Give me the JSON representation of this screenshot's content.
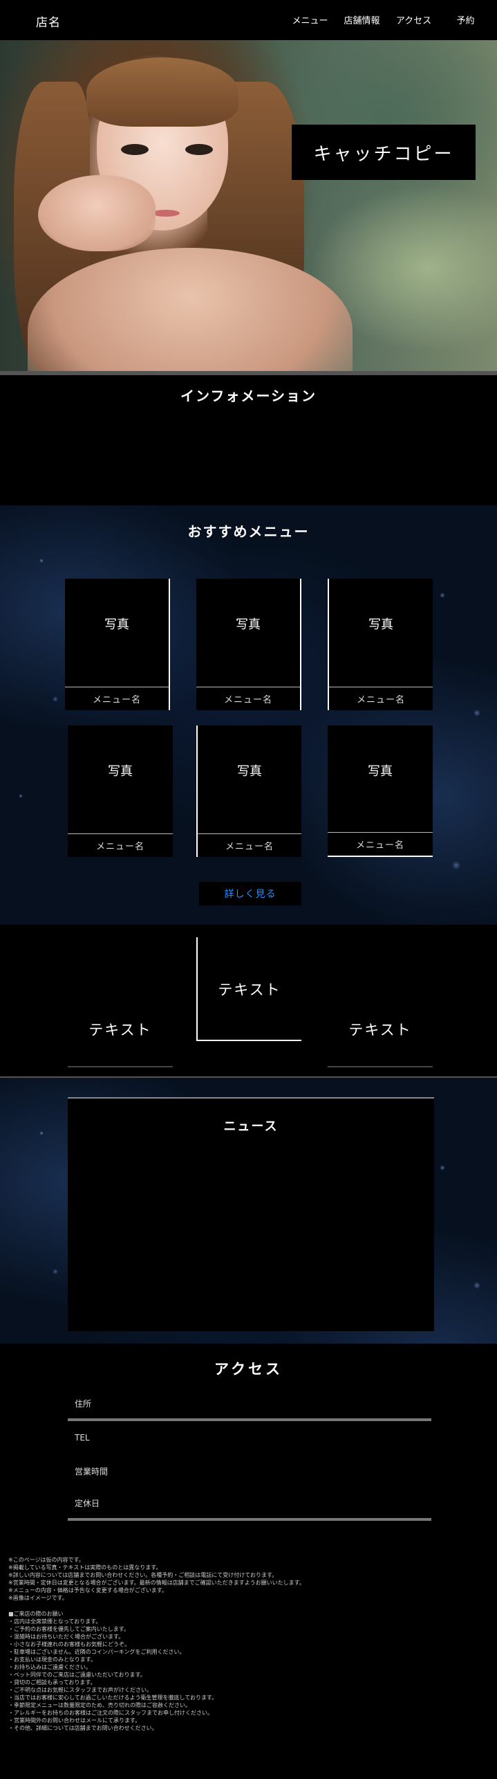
{
  "header": {
    "shop_name": "店名",
    "nav": [
      "メニュー",
      "店舗情報",
      "アクセス",
      "予約"
    ]
  },
  "hero": {
    "catch_copy": "キャッチコピー"
  },
  "information": {
    "title": "インフォメーション"
  },
  "menu": {
    "title": "おすすめメニュー",
    "cards": [
      {
        "photo": "写真",
        "caption": "メニュー名"
      },
      {
        "photo": "写真",
        "caption": "メニュー名"
      },
      {
        "photo": "写真",
        "caption": "メニュー名"
      },
      {
        "photo": "写真",
        "caption": "メニュー名"
      },
      {
        "photo": "写真",
        "caption": "メニュー名"
      },
      {
        "photo": "写真",
        "caption": "メニュー名"
      }
    ],
    "more_label": "詳しく見る"
  },
  "text_columns": [
    "テキスト",
    "テキスト",
    "テキスト"
  ],
  "news": {
    "title": "ニュース"
  },
  "access": {
    "title": "アクセス",
    "items": [
      "住所",
      "TEL",
      "営業時間",
      "定休日"
    ]
  },
  "notes": [
    "※このページは仮の内容です。",
    "※掲載している写真・テキストは実際のものとは異なります。",
    "※詳しい内容については店舗までお問い合わせください。各種予約・ご相談は電話にて受け付けております。",
    "※営業時間・定休日は変更となる場合がございます。最新の情報は店舗までご確認いただきますようお願いいたします。",
    "※メニューの内容・価格は予告なく変更する場合がございます。",
    "※画像はイメージです。",
    "",
    "■ご来店の際のお願い",
    "・店内は全席禁煙となっております。",
    "・ご予約のお客様を優先してご案内いたします。",
    "・混雑時はお待ちいただく場合がございます。",
    "・小さなお子様連れのお客様もお気軽にどうぞ。",
    "・駐車場はございません。近隣のコインパーキングをご利用ください。",
    "・お支払いは現金のみとなります。",
    "・お持ち込みはご遠慮ください。",
    "・ペット同伴でのご来店はご遠慮いただいております。",
    "・貸切のご相談も承っております。",
    "・ご不明な点はお気軽にスタッフまでお声がけください。",
    "・当店ではお客様に安心してお過ごしいただけるよう衛生管理を徹底しております。",
    "・季節限定メニューは数量限定のため、売り切れの際はご容赦ください。",
    "・アレルギーをお持ちのお客様はご注文の際にスタッフまでお申し付けください。",
    "・営業時間外のお問い合わせはメールにて承ります。",
    "・その他、詳細については店舗までお問い合わせください。"
  ]
}
